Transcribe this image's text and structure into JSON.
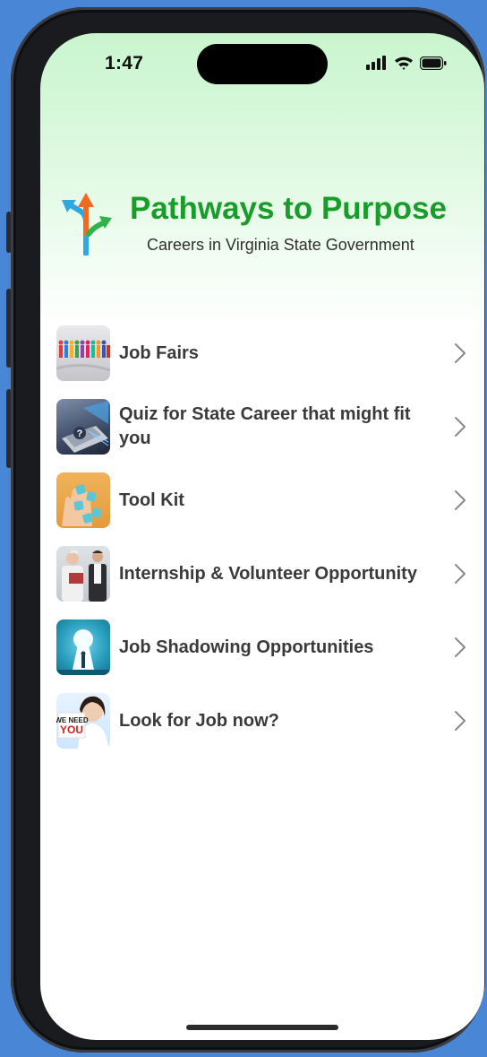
{
  "status_bar": {
    "time": "1:47",
    "signal_icon": "cellular-signal-icon",
    "wifi_icon": "wifi-icon",
    "battery_icon": "battery-icon"
  },
  "header": {
    "logo_icon": "diverging-arrows-logo-icon",
    "title": "Pathways to Purpose",
    "subtitle": "Careers in Virginia State Government",
    "title_color": "#1a9c2b"
  },
  "menu": {
    "chevron_icon": "chevron-right-icon",
    "items": [
      {
        "label": "Job Fairs",
        "thumbnail": "job-fairs-crowd-thumbnail"
      },
      {
        "label": "Quiz for State Career that might fit you",
        "thumbnail": "quiz-laptop-thumbnail"
      },
      {
        "label": "Tool Kit",
        "thumbnail": "tool-kit-blocks-thumbnail"
      },
      {
        "label": "Internship & Volunteer Opportunity",
        "thumbnail": "internship-people-thumbnail"
      },
      {
        "label": "Job Shadowing Opportunities",
        "thumbnail": "keyhole-thumbnail"
      },
      {
        "label": "Look for Job now?",
        "thumbnail": "we-need-you-thumbnail",
        "thumbnail_text_1": "WE NEED",
        "thumbnail_text_2": "YOU"
      }
    ]
  },
  "colors": {
    "background": "#4a86d6",
    "gradient_top": "#c9f5ce",
    "label": "#3a3a3a"
  }
}
